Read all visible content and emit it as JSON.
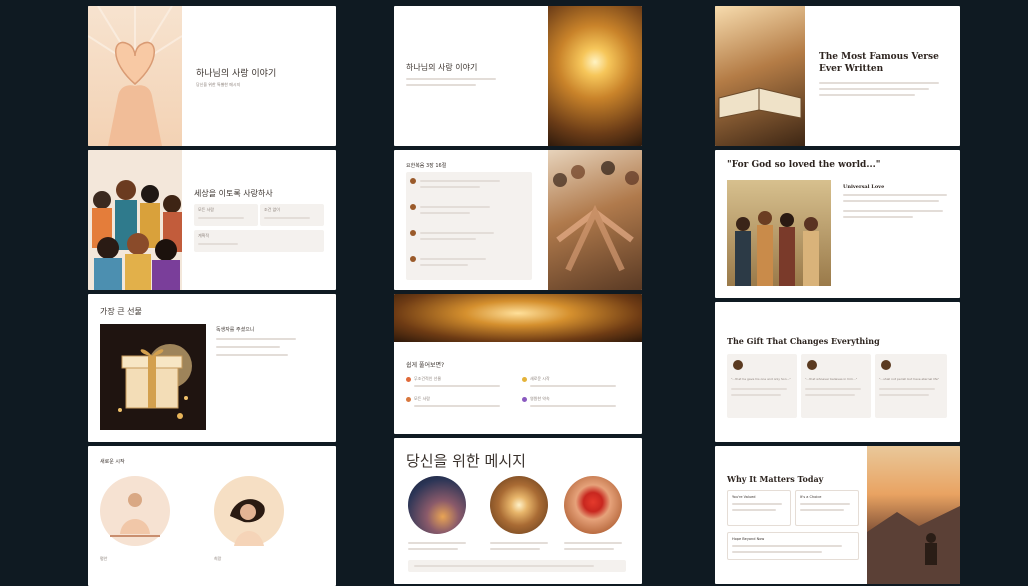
{
  "left": {
    "s1": {
      "title": "하나님의 사랑 이야기",
      "sub": "당신을 위한 특별한 메시지"
    },
    "s2": {
      "title": "세상을 이토록 사랑하사",
      "cards": [
        "모든 사람",
        "조건 없이",
        "계획적",
        ""
      ]
    },
    "s3": {
      "title": "가장 큰 선물",
      "head": "독생자를 주셨으니"
    },
    "s4": {
      "title": "새로운 시작",
      "cap1": "평안",
      "cap2": "희망"
    }
  },
  "middle": {
    "s1": {
      "title": "하나님의 사랑 이야기"
    },
    "s2": {
      "title": "요한복음 3장 16절"
    },
    "s3": {
      "title": "쉽게 풀어보면?",
      "items": [
        "무조건적인 선물",
        "새로운 시작",
        "모든 사람",
        "영원한 약속"
      ]
    },
    "s4": {
      "title": "당신을 위한 메시지"
    }
  },
  "right": {
    "s1": {
      "title_line1": "The Most Famous Verse",
      "title_line2": "Ever Written"
    },
    "s2": {
      "title": "\"For God so loved the world...\"",
      "sub": "Universal Love"
    },
    "s3": {
      "title": "The Gift That Changes Everything",
      "cards": [
        "\"...that he gave his one and only Son...\"",
        "\"...that whoever believes in him...\"",
        "\"...shall not perish but have eternal life\""
      ]
    },
    "s4": {
      "title": "Why It Matters Today",
      "cards": [
        "You're Valued",
        "It's a Choice",
        "Hope Beyond Now"
      ]
    }
  }
}
